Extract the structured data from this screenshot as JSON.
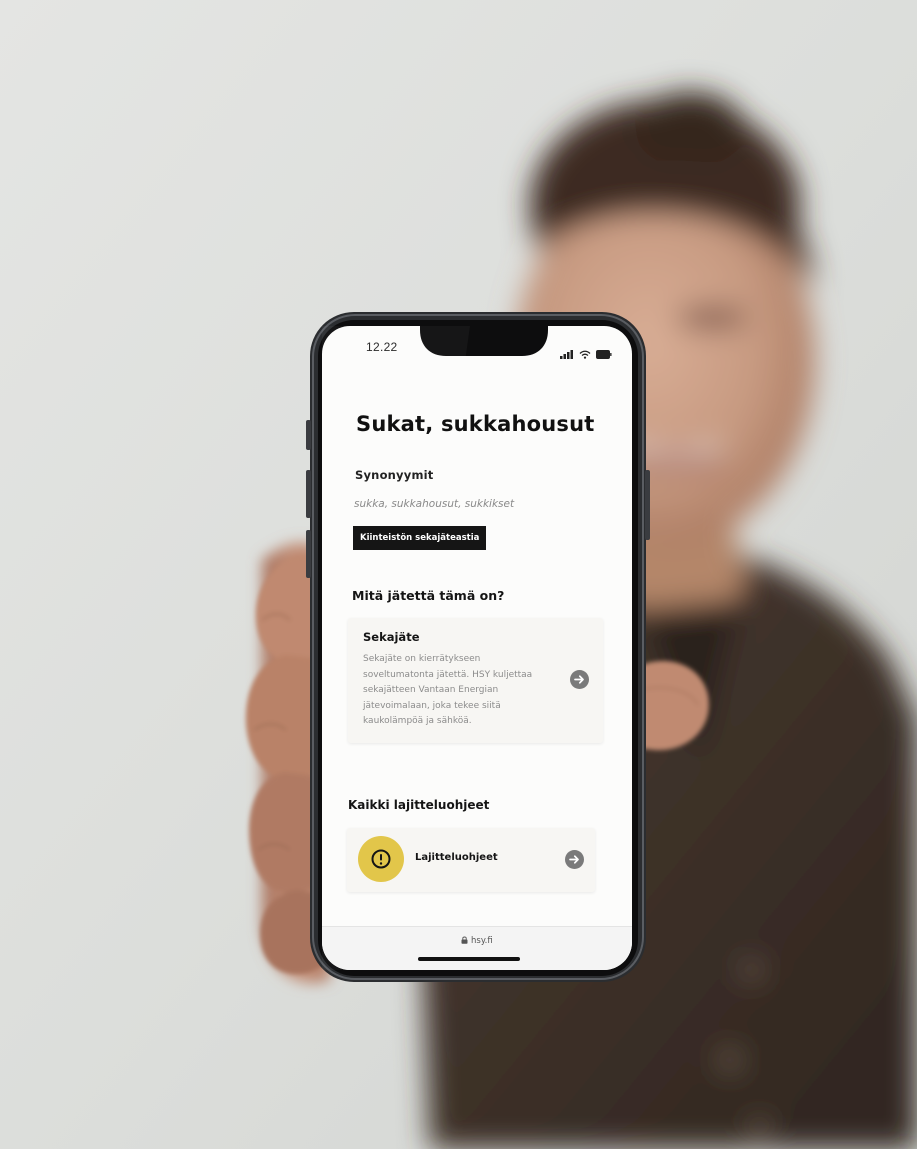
{
  "status": {
    "time": "12.22"
  },
  "page": {
    "title": "Sukat, sukkahousut",
    "synonyms_heading": "Synonyymit",
    "synonyms": "sukka, sukkahousut, sukkikset",
    "bin_tag": "Kiinteistön sekajäteastia",
    "question_heading": "Mitä jätettä tämä on?"
  },
  "waste_card": {
    "title": "Sekajäte",
    "lines": [
      "Sekajäte on kierrätykseen",
      "soveltumatonta jätettä. HSY kuljettaa",
      "sekajätteen Vantaan Energian",
      "jätevoimalaan, joka tekee siitä",
      "kaukolämpöä ja sähköä."
    ]
  },
  "all_instructions": {
    "heading": "Kaikki lajitteluohjeet",
    "card_label": "Lajitteluohjeet"
  },
  "browser": {
    "url": "hsy.fi"
  },
  "colors": {
    "wall": "#dcdedb",
    "phone_frame": "#2a2c2f",
    "screen": "#fcfcfb",
    "shirt": "#3a2e27",
    "hair": "#3c2c22",
    "skin": "#c99a82",
    "hand": "#b98670",
    "accent_yellow": "#e2c64a",
    "tag_black": "#151515"
  },
  "icons": {
    "status": [
      "signal-icon",
      "wifi-icon",
      "battery-icon"
    ],
    "card_arrow": "arrow-right-circle-icon",
    "guide": "exclamation-circle-icon",
    "url": "lock-icon"
  }
}
